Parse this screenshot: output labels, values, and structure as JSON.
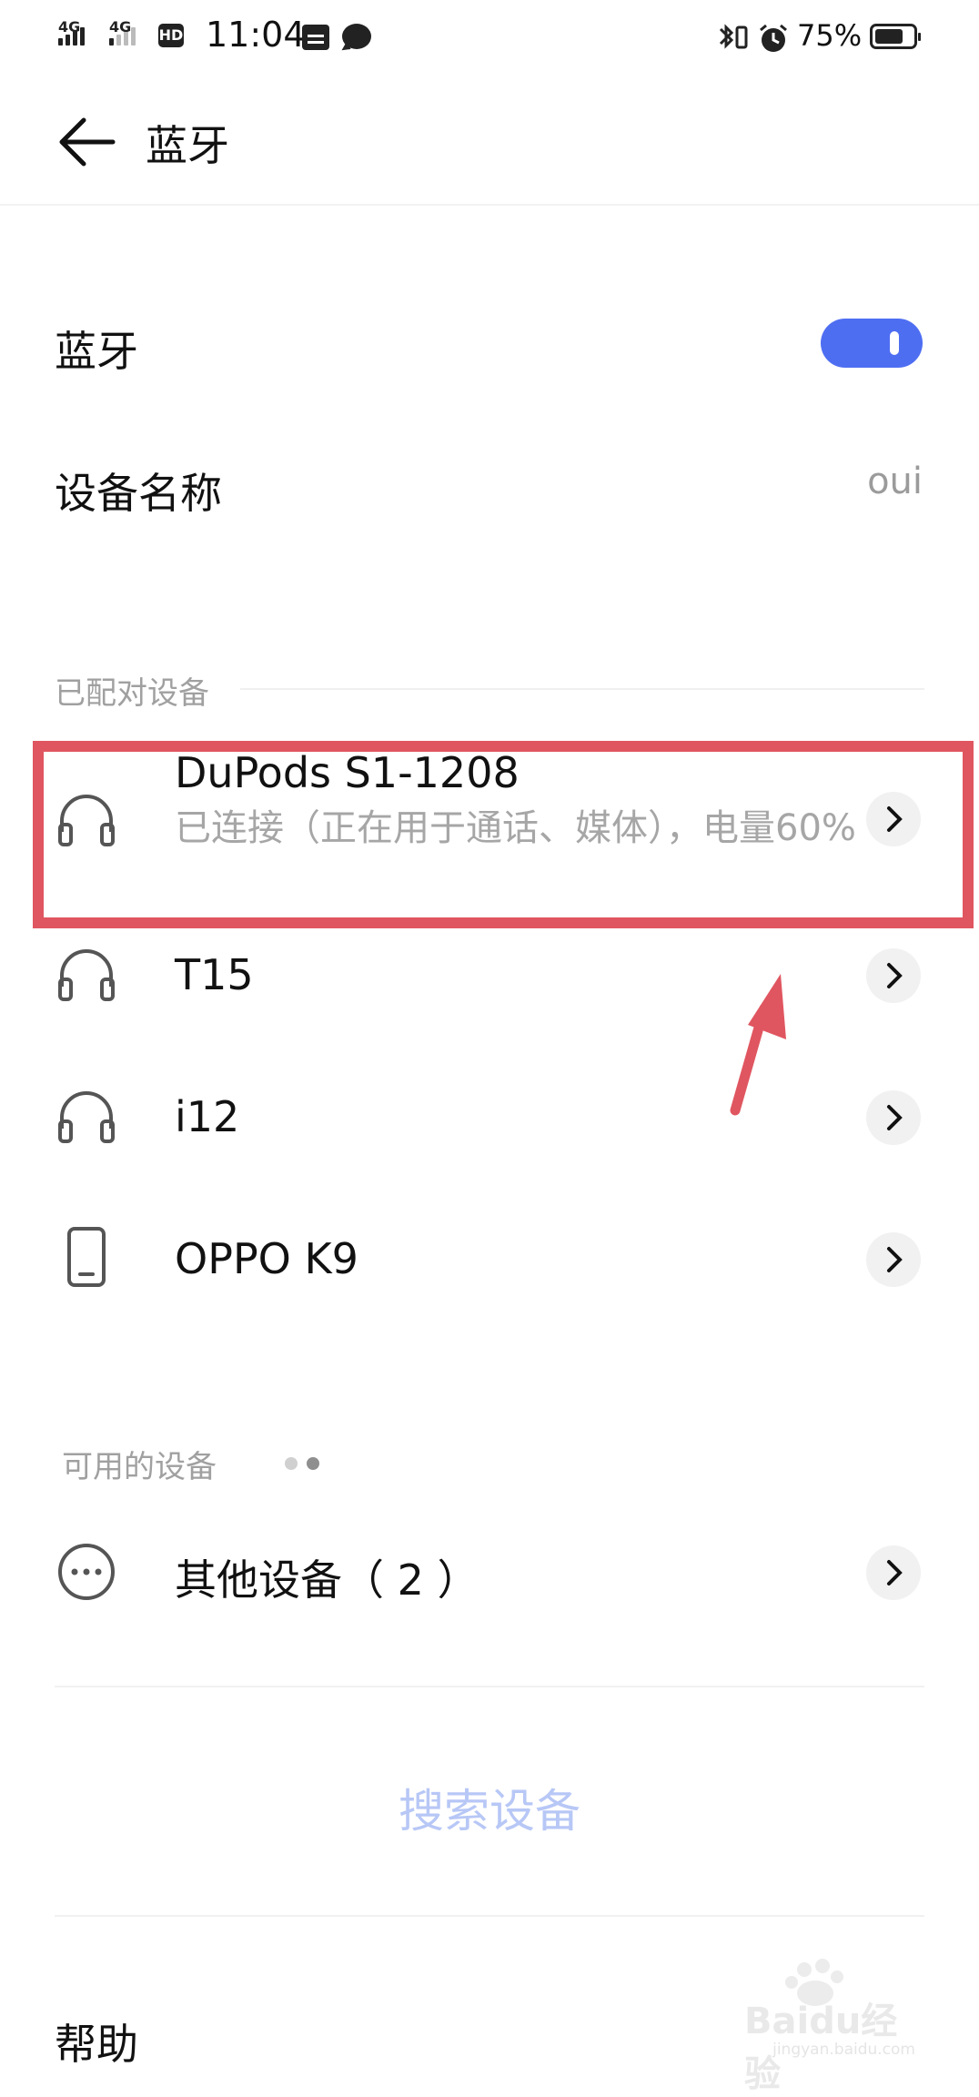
{
  "status_bar": {
    "signal1_label": "4G",
    "signal2_label": "4G",
    "hd_label": "HD",
    "time": "11:04",
    "battery_percent_text": "75%",
    "battery_level": 0.75
  },
  "header": {
    "title": "蓝牙"
  },
  "bluetooth_row": {
    "label": "蓝牙",
    "enabled": true,
    "accent_color": "#4e6ef2"
  },
  "device_name_row": {
    "label": "设备名称",
    "value": "oui"
  },
  "paired_section": {
    "title": "已配对设备",
    "devices": [
      {
        "name": "DuPods S1-1208",
        "status": "已连接（正在用于通话、媒体），电量60%",
        "icon": "headphones-icon"
      },
      {
        "name": "T15",
        "icon": "headphones-icon"
      },
      {
        "name": "i12",
        "icon": "headphones-icon"
      },
      {
        "name": "OPPO K9",
        "icon": "phone-icon"
      }
    ]
  },
  "available_section": {
    "title": "可用的设备",
    "items": [
      {
        "name": "其他设备（ 2 ）",
        "icon": "more-dots-icon"
      }
    ]
  },
  "search_button": {
    "label": "搜索设备",
    "color": "#b7c7f6"
  },
  "help_row": {
    "label": "帮助"
  },
  "annotation": {
    "highlight_color": "#e05660"
  },
  "watermark": {
    "text": "Baidu经验",
    "url": "jingyan.baidu.com"
  }
}
